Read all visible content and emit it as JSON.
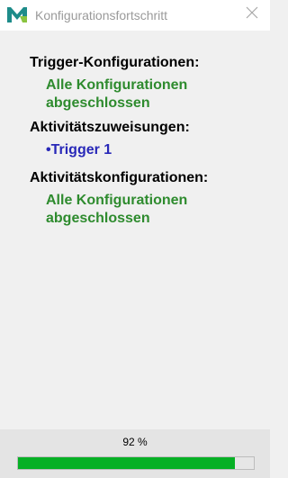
{
  "window": {
    "title": "Konfigurationsfortschritt",
    "app_icon": "m-logo-icon",
    "close_icon": "close-icon"
  },
  "sections": [
    {
      "heading": "Trigger-Konfigurationen:",
      "status": "Alle Konfigurationen abgeschlossen",
      "status_color": "#2e8b2e"
    },
    {
      "heading": "Aktivitätszuweisungen:",
      "status": "•Trigger 1",
      "status_color": "#2828b8"
    },
    {
      "heading": "Aktivitätskonfigurationen:",
      "status": "Alle Konfigurationen abgeschlossen",
      "status_color": "#2e8b2e"
    }
  ],
  "progress": {
    "label": "92 %",
    "value": 0.92,
    "fill_color": "#06b025"
  }
}
